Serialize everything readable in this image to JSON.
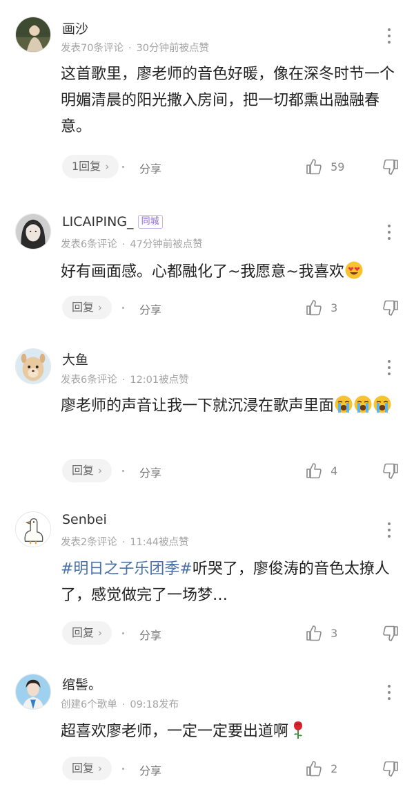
{
  "comments": [
    {
      "username": "画沙",
      "tag": "",
      "meta_left": "发表70条评论",
      "meta_right": "30分钟前被点赞",
      "text": "这首歌里，廖老师的音色好暖，像在深冬时节一个明媚清晨的阳光撒入房间，把一切都熏出融融春意。",
      "reply_label": "1回复",
      "share_label": "分享",
      "likes": "59"
    },
    {
      "username": "LICAIPING_",
      "tag": "同城",
      "meta_left": "发表6条评论",
      "meta_right": "47分钟前被点赞",
      "text": "好有画面感。心都融化了~我愿意~我喜欢",
      "reply_label": "回复",
      "share_label": "分享",
      "likes": "3"
    },
    {
      "username": "大鱼",
      "tag": "",
      "meta_left": "发表6条评论",
      "meta_right": "12:01被点赞",
      "text": "廖老师的声音让我一下就沉浸在歌声里面",
      "reply_label": "回复",
      "share_label": "分享",
      "likes": "4"
    },
    {
      "username": "Senbei",
      "tag": "",
      "meta_left": "发表2条评论",
      "meta_right": "11:44被点赞",
      "hashtag": "#明日之子乐团季#",
      "text": "听哭了，廖俊涛的音色太撩人了，感觉做完了一场梦…",
      "reply_label": "回复",
      "share_label": "分享",
      "likes": "3"
    },
    {
      "username": "绾髻。",
      "tag": "",
      "meta_left": "创建6个歌单",
      "meta_right": "09:18发布",
      "text": "超喜欢廖老师，一定一定要出道啊",
      "reply_label": "回复",
      "share_label": "分享",
      "likes": "2"
    }
  ],
  "icons": {
    "chevron": "›",
    "like": "thumbs-up-icon",
    "dislike": "thumbs-down-icon",
    "more": "more-vertical-icon"
  }
}
